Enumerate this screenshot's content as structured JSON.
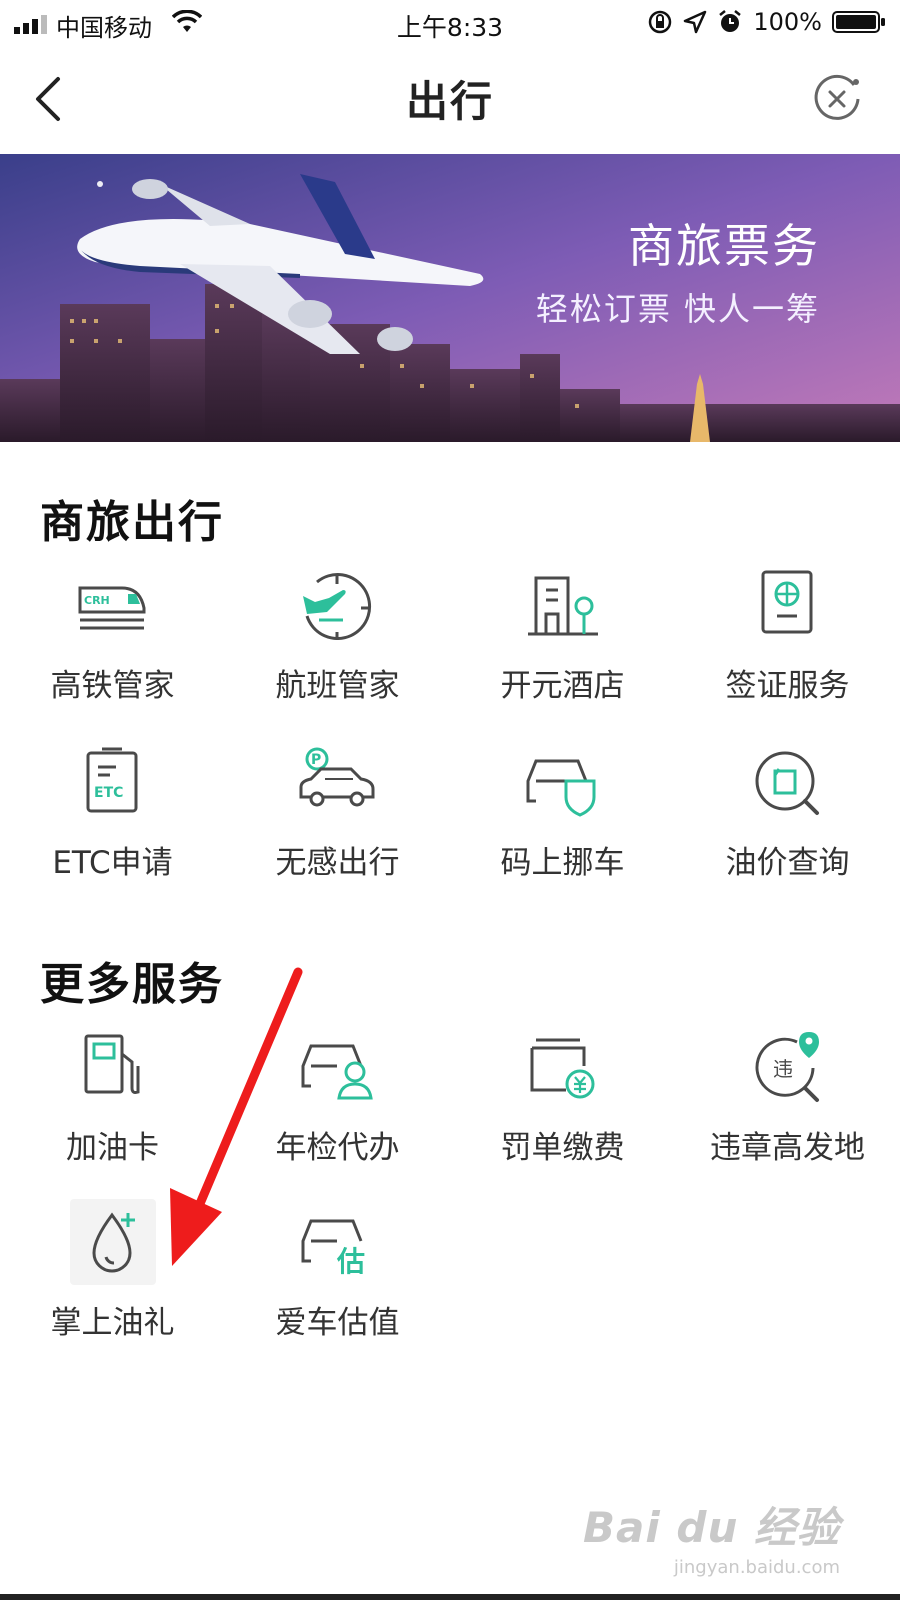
{
  "status_bar": {
    "carrier": "中国移动",
    "time": "上午8:33",
    "battery": "100%",
    "icons": [
      "signal-icon",
      "wifi-icon",
      "orientation-lock-icon",
      "location-icon",
      "alarm-icon",
      "battery-icon"
    ]
  },
  "nav": {
    "title": "出行",
    "back_icon": "chevron-left-icon",
    "close_icon": "close-circle-icon"
  },
  "banner": {
    "title": "商旅票务",
    "subtitle": "轻松订票 快人一筹"
  },
  "sections": [
    {
      "title": "商旅出行",
      "items": [
        {
          "label": "高铁管家",
          "icon": "high-speed-train-icon"
        },
        {
          "label": "航班管家",
          "icon": "flight-clock-icon"
        },
        {
          "label": "开元酒店",
          "icon": "hotel-icon"
        },
        {
          "label": "签证服务",
          "icon": "passport-icon"
        },
        {
          "label": "ETC申请",
          "icon": "etc-card-icon"
        },
        {
          "label": "无感出行",
          "icon": "parking-car-icon"
        },
        {
          "label": "码上挪车",
          "icon": "car-shield-icon"
        },
        {
          "label": "油价查询",
          "icon": "fuel-search-icon"
        }
      ]
    },
    {
      "title": "更多服务",
      "items": [
        {
          "label": "加油卡",
          "icon": "gas-pump-icon"
        },
        {
          "label": "年检代办",
          "icon": "car-inspection-icon"
        },
        {
          "label": "罚单缴费",
          "icon": "fine-payment-icon"
        },
        {
          "label": "违章高发地",
          "icon": "violation-location-icon"
        },
        {
          "label": "掌上油礼",
          "icon": "oil-drop-plus-icon"
        },
        {
          "label": "爱车估值",
          "icon": "car-valuation-icon"
        }
      ]
    }
  ],
  "colors": {
    "accent": "#2dbf9b",
    "icon_gray": "#4a4a4a",
    "annotation_arrow": "#ee1c1c"
  },
  "watermark": {
    "main": "Bai du 经验",
    "sub": "jingyan.baidu.com"
  }
}
